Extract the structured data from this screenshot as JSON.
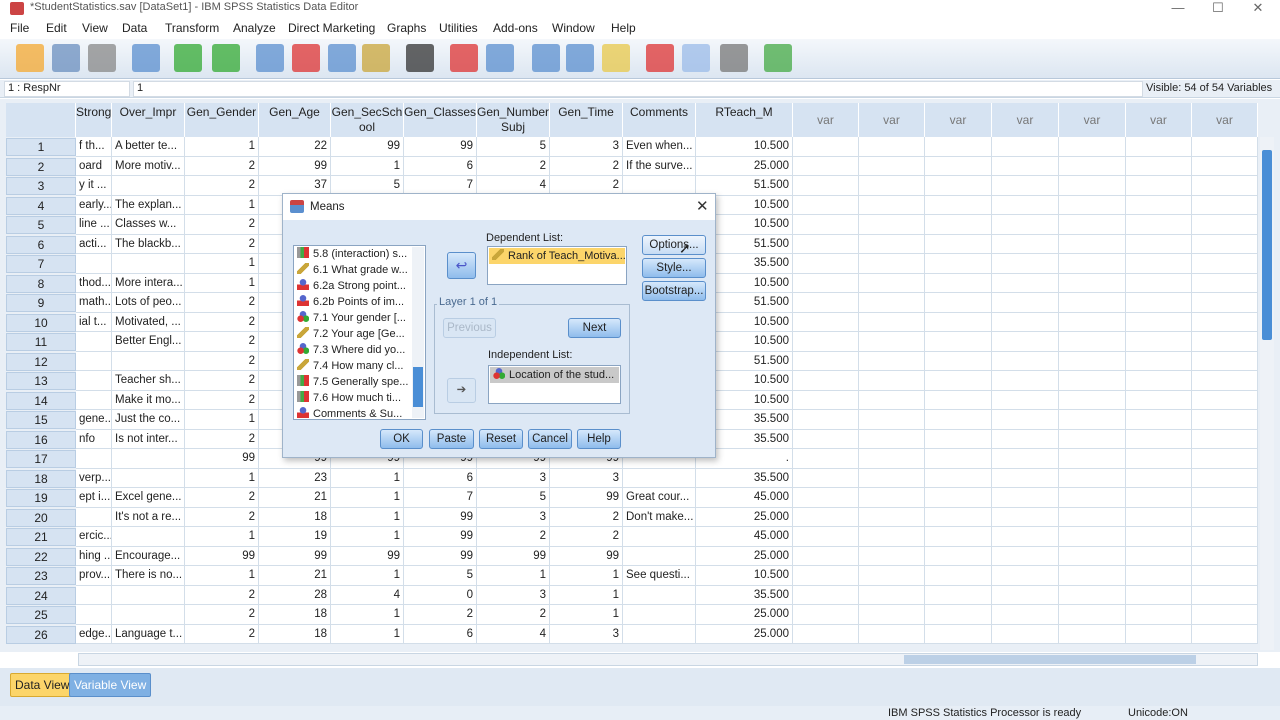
{
  "window": {
    "title": "*StudentStatistics.sav [DataSet1] - IBM SPSS Statistics Data Editor"
  },
  "menu": [
    "File",
    "Edit",
    "View",
    "Data",
    "Transform",
    "Analyze",
    "Direct Marketing",
    "Graphs",
    "Utilities",
    "Add-ons",
    "Window",
    "Help"
  ],
  "toolbar": [
    "open-icon",
    "save-icon",
    "print-icon",
    "recall-dialog-icon",
    "undo-icon",
    "redo-icon",
    "goto-case-icon",
    "goto-variable-icon",
    "variables-icon",
    "value-labels-icon",
    "find-icon",
    "insert-cases-icon",
    "insert-variable-icon",
    "split-file-icon",
    "weight-cases-icon",
    "select-cases-icon",
    "value-labels-toggle-icon",
    "use-sets-icon",
    "show-all-icon",
    "spell-check-icon"
  ],
  "cellbar": {
    "name": "1 : RespNr",
    "value": "1",
    "visible": "Visible: 54 of 54 Variables"
  },
  "columns": [
    "Strong",
    "Over_Impr",
    "Gen_Gender",
    "Gen_Age",
    "Gen_SecSch ool",
    "Gen_Classes",
    "Gen_Number Subj",
    "Gen_Time",
    "Comments",
    "RTeach_M",
    "var",
    "var",
    "var",
    "var",
    "var",
    "var",
    "var"
  ],
  "rows": [
    [
      "1",
      "f th...",
      "A better te...",
      "1",
      "22",
      "99",
      "99",
      "5",
      "3",
      "Even when...",
      "10.500"
    ],
    [
      "2",
      "oard",
      "More motiv...",
      "2",
      "99",
      "1",
      "6",
      "2",
      "2",
      "If the surve...",
      "25.000"
    ],
    [
      "3",
      "y it ...",
      "",
      "2",
      "37",
      "5",
      "7",
      "4",
      "2",
      "",
      "51.500"
    ],
    [
      "4",
      "early...",
      "The explan...",
      "1",
      "",
      "",
      "",
      "",
      "",
      "",
      "10.500"
    ],
    [
      "5",
      "line ...",
      "Classes w...",
      "2",
      "",
      "",
      "",
      "",
      "",
      "",
      "10.500"
    ],
    [
      "6",
      "acti...",
      "The blackb...",
      "2",
      "",
      "",
      "",
      "",
      "",
      "",
      "51.500"
    ],
    [
      "7",
      "",
      "",
      "1",
      "",
      "",
      "",
      "",
      "",
      "",
      "35.500"
    ],
    [
      "8",
      "thod...",
      "More intera...",
      "1",
      "",
      "",
      "",
      "",
      "",
      "",
      "10.500"
    ],
    [
      "9",
      "math...",
      "Lots of peo...",
      "2",
      "",
      "",
      "",
      "",
      "",
      "",
      "51.500"
    ],
    [
      "10",
      "ial t...",
      "Motivated, ...",
      "2",
      "",
      "",
      "",
      "",
      "",
      "",
      "10.500"
    ],
    [
      "11",
      "",
      "Better Engl...",
      "2",
      "",
      "",
      "",
      "",
      "",
      "",
      "10.500"
    ],
    [
      "12",
      "",
      "",
      "2",
      "",
      "",
      "",
      "",
      "",
      "",
      "51.500"
    ],
    [
      "13",
      "",
      "Teacher sh...",
      "2",
      "",
      "",
      "",
      "",
      "",
      "",
      "10.500"
    ],
    [
      "14",
      "",
      "Make it mo...",
      "2",
      "",
      "",
      "",
      "",
      "",
      "",
      "10.500"
    ],
    [
      "15",
      "gene...",
      "Just the co...",
      "1",
      "",
      "",
      "",
      "",
      "",
      "",
      "35.500"
    ],
    [
      "16",
      "nfo",
      "Is not inter...",
      "2",
      "",
      "",
      "",
      "",
      "",
      "",
      "35.500"
    ],
    [
      "17",
      "",
      "",
      "99",
      "99",
      "99",
      "99",
      "99",
      "99",
      "",
      "."
    ],
    [
      "18",
      "verp...",
      "",
      "1",
      "23",
      "1",
      "6",
      "3",
      "3",
      "",
      "35.500"
    ],
    [
      "19",
      "ept i...",
      "Excel gene...",
      "2",
      "21",
      "1",
      "7",
      "5",
      "99",
      "Great cour...",
      "45.000"
    ],
    [
      "20",
      "",
      "It's not a re...",
      "2",
      "18",
      "1",
      "99",
      "3",
      "2",
      "Don't make...",
      "25.000"
    ],
    [
      "21",
      "ercic...",
      "",
      "1",
      "19",
      "1",
      "99",
      "2",
      "2",
      "",
      "45.000"
    ],
    [
      "22",
      "hing ...",
      "Encourage...",
      "99",
      "99",
      "99",
      "99",
      "99",
      "99",
      "",
      "25.000"
    ],
    [
      "23",
      "prov...",
      "There is no...",
      "1",
      "21",
      "1",
      "5",
      "1",
      "1",
      "See questi...",
      "10.500"
    ],
    [
      "24",
      "",
      "",
      "2",
      "28",
      "4",
      "0",
      "3",
      "1",
      "",
      "35.500"
    ],
    [
      "25",
      "",
      "",
      "2",
      "18",
      "1",
      "2",
      "2",
      "1",
      "",
      "25.000"
    ],
    [
      "26",
      "edge...",
      "Language t...",
      "2",
      "18",
      "1",
      "6",
      "4",
      "3",
      "",
      "25.000"
    ]
  ],
  "tabs": {
    "data_view": "Data View",
    "variable_view": "Variable View"
  },
  "status": {
    "processor": "IBM SPSS Statistics Processor is ready",
    "unicode": "Unicode:ON"
  },
  "dialog": {
    "title": "Means",
    "variables": [
      {
        "label": "5.8 (interaction) s...",
        "type": "ord"
      },
      {
        "label": "6.1 What grade w...",
        "type": "scale"
      },
      {
        "label": "6.2a Strong point...",
        "type": "str"
      },
      {
        "label": "6.2b Points of im...",
        "type": "str"
      },
      {
        "label": "7.1 Your gender [...",
        "type": "nom"
      },
      {
        "label": "7.2 Your age [Ge...",
        "type": "scale"
      },
      {
        "label": "7.3 Where did yo...",
        "type": "nom"
      },
      {
        "label": "7.4 How many cl...",
        "type": "scale"
      },
      {
        "label": "7.5 Generally spe...",
        "type": "ord"
      },
      {
        "label": "7.6 How much ti...",
        "type": "ord"
      },
      {
        "label": "Comments & Su...",
        "type": "str"
      }
    ],
    "dependent_label": "Dependent List:",
    "dependent_items": [
      "Rank of Teach_Motiva..."
    ],
    "layer_label": "Layer 1 of 1",
    "previous": "Previous",
    "next": "Next",
    "independent_label": "Independent List:",
    "independent_items": [
      "Location of the stud..."
    ],
    "options": "Options...",
    "style": "Style...",
    "bootstrap": "Bootstrap...",
    "ok": "OK",
    "paste": "Paste",
    "reset": "Reset",
    "cancel": "Cancel",
    "help": "Help"
  }
}
